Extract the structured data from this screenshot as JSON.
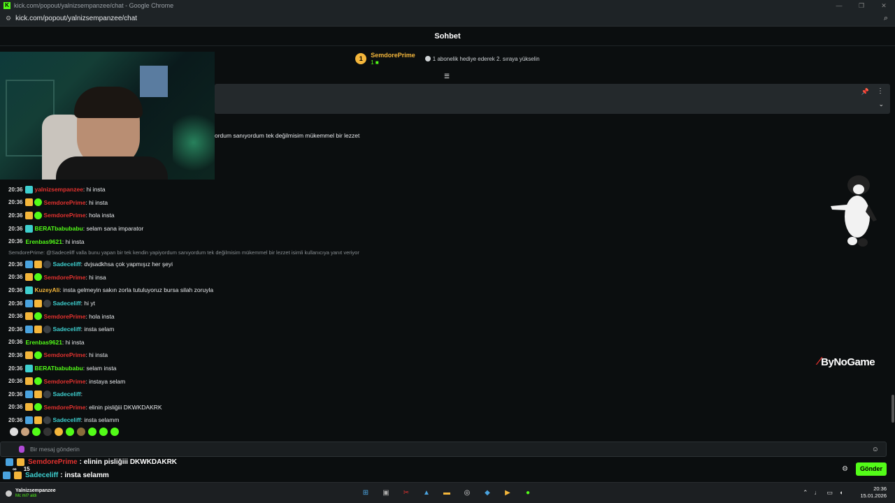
{
  "window": {
    "title": "kick.com/popout/yalnizsempanzee/chat - Google Chrome",
    "url": "kick.com/popout/yalnizsempanzee/chat",
    "controls": [
      "—",
      "❐",
      "✕"
    ]
  },
  "header": {
    "title": "Sohbet"
  },
  "leaderboard": {
    "rank": "1",
    "name": "SemdorePrime",
    "count": "1",
    "hint": "1 abonelik hediye ederek 2. sıraya yükselin"
  },
  "pinned": {
    "text": "ordum sanıyordum tek değilmisim mükemmel bir lezzet"
  },
  "chat": {
    "messages": [
      {
        "time": "20:36",
        "badges": [
          "teal"
        ],
        "user": "yalnizsempanzee",
        "color": "#e3322f",
        "text": ": hi insta"
      },
      {
        "time": "20:36",
        "badges": [
          "gold",
          "green"
        ],
        "user": "SemdorePrime",
        "color": "#e3322f",
        "text": ": hi insta"
      },
      {
        "time": "20:36",
        "badges": [
          "gold",
          "green"
        ],
        "user": "SemdorePrime",
        "color": "#e3322f",
        "text": ": hola insta"
      },
      {
        "time": "20:36",
        "badges": [
          "teal"
        ],
        "user": "BERATbabubabu",
        "color": "#53fc18",
        "text": ": selam sana imparator"
      },
      {
        "time": "20:36",
        "badges": [],
        "user": "Erenbas9621",
        "color": "#53fc18",
        "text": ": hi insta"
      },
      {
        "reply": "SemdorePrime: @Sadeceliff valla bunu yapan bir tek kendin yapiyordum sanıyordum tek değilmisim mükemmel bir lezzet isimli kullanıcıya yanıt veriyor"
      },
      {
        "time": "20:36",
        "badges": [
          "blue",
          "gold",
          "dark"
        ],
        "user": "Sadeceliff",
        "color": "#3ecfcf",
        "text": ": dvjsadkhsa çok yapmışız her şeyi"
      },
      {
        "time": "20:36",
        "badges": [
          "gold",
          "green"
        ],
        "user": "SemdorePrime",
        "color": "#e3322f",
        "text": ": hi insa"
      },
      {
        "time": "20:36",
        "badges": [
          "teal"
        ],
        "user": "KuzeyAli",
        "color": "#f4b63b",
        "text": ": insta gelmeyin sakın zorla tutuluyoruz bursa silah zoruyla"
      },
      {
        "time": "20:36",
        "badges": [
          "blue",
          "gold",
          "dark"
        ],
        "user": "Sadeceliff",
        "color": "#3ecfcf",
        "text": ": hi yt"
      },
      {
        "time": "20:36",
        "badges": [
          "gold",
          "green"
        ],
        "user": "SemdorePrime",
        "color": "#e3322f",
        "text": ": hola insta"
      },
      {
        "time": "20:36",
        "badges": [
          "blue",
          "gold",
          "dark"
        ],
        "user": "Sadeceliff",
        "color": "#3ecfcf",
        "text": ": insta selam"
      },
      {
        "time": "20:36",
        "badges": [],
        "user": "Erenbas9621",
        "color": "#53fc18",
        "text": ": hi insta"
      },
      {
        "time": "20:36",
        "badges": [
          "gold",
          "green"
        ],
        "user": "SemdorePrime",
        "color": "#e3322f",
        "text": ": hi insta"
      },
      {
        "time": "20:36",
        "badges": [
          "teal"
        ],
        "user": "BERATbabubabu",
        "color": "#53fc18",
        "text": ": selam insta"
      },
      {
        "time": "20:36",
        "badges": [
          "gold",
          "green"
        ],
        "user": "SemdorePrime",
        "color": "#e3322f",
        "text": ": instaya selam"
      },
      {
        "time": "20:36",
        "badges": [
          "blue",
          "gold",
          "dark"
        ],
        "user": "Sadeceliff",
        "color": "#3ecfcf",
        "text": ":"
      },
      {
        "time": "20:36",
        "badges": [
          "gold",
          "green"
        ],
        "user": "SemdorePrime",
        "color": "#e3322f",
        "text": ": elinin pisliğiii DKWKDAKRK"
      },
      {
        "time": "20:36",
        "badges": [
          "blue",
          "gold",
          "dark"
        ],
        "user": "Sadeceliff",
        "color": "#3ecfcf",
        "text": ": insta selamm"
      }
    ]
  },
  "input": {
    "placeholder": "Bir mesaj gönderin"
  },
  "send_button": "Gönder",
  "overlay": {
    "line1_user": "SemdorePrime",
    "line1_text": " : elinin pisliğiii DKWKDAKRK",
    "line2_user": "Sadeceliff",
    "line2_text": " : insta selamm",
    "viewers": "∞",
    "count": "15"
  },
  "brand": {
    "logo_text": "ByNoGame"
  },
  "taskbar": {
    "user": "Yalnizsempanzee",
    "status": "Mc mi? aldı",
    "time": "20:36",
    "date": "15.01.2026"
  },
  "colors": {
    "kick_green": "#53fc18",
    "gold": "#f4b63b",
    "red": "#e3322f",
    "teal": "#3ecfcf"
  }
}
